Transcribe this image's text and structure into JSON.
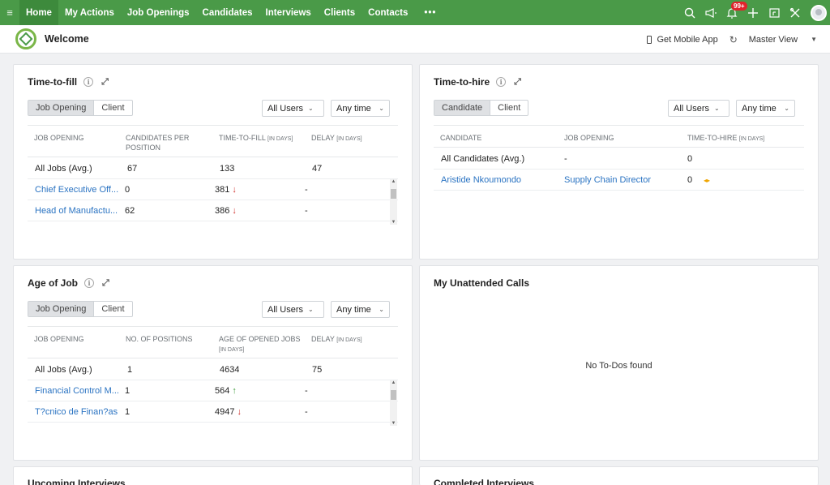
{
  "nav": {
    "items": [
      "Home",
      "My Actions",
      "Job Openings",
      "Candidates",
      "Interviews",
      "Clients",
      "Contacts"
    ],
    "more": "•••",
    "notification_badge": "99+",
    "icons": [
      "search-icon",
      "megaphone-icon",
      "bell-icon",
      "plus-icon",
      "calendar-icon",
      "tools-icon",
      "avatar"
    ]
  },
  "subheader": {
    "welcome": "Welcome",
    "mobile_app": "Get Mobile App",
    "view": "Master View"
  },
  "ttf": {
    "title": "Time-to-fill",
    "tabs": [
      "Job Opening",
      "Client"
    ],
    "users": "All Users",
    "time": "Any time",
    "headers": {
      "job": "JOB OPENING",
      "cand1": "CANDIDATES PER",
      "cand2": "POSITION",
      "ttf": "TIME-TO-FILL",
      "ttf_unit": "[IN DAYS]",
      "delay": "DELAY",
      "delay_unit": "[IN DAYS]"
    },
    "rows": [
      {
        "job": "All Jobs (Avg.)",
        "cand": "67",
        "ttf": "133",
        "arrow": "",
        "delay": "47"
      },
      {
        "job": "Chief Executive Off...",
        "cand": "0",
        "ttf": "381",
        "arrow": "↓",
        "delay": "-"
      },
      {
        "job": "Head of Manufactu...",
        "cand": "62",
        "ttf": "386",
        "arrow": "↓",
        "delay": "-"
      }
    ]
  },
  "tth": {
    "title": "Time-to-hire",
    "tabs": [
      "Candidate",
      "Client"
    ],
    "users": "All Users",
    "time": "Any time",
    "headers": {
      "cand": "CANDIDATE",
      "job": "JOB OPENING",
      "tth": "TIME-TO-HIRE",
      "tth_unit": "[IN DAYS]"
    },
    "rows": [
      {
        "cand": "All Candidates (Avg.)",
        "job": "-",
        "tth": "0"
      },
      {
        "cand": "Aristide Nkoumondo",
        "job": "Supply Chain Director",
        "tth": "0",
        "flag": "◂▸"
      }
    ]
  },
  "aoj": {
    "title": "Age of Job",
    "tabs": [
      "Job Opening",
      "Client"
    ],
    "users": "All Users",
    "time": "Any time",
    "headers": {
      "job": "JOB OPENING",
      "pos": "NO. OF POSITIONS",
      "age1": "AGE OF OPENED JOBS",
      "age_unit": "[IN DAYS]",
      "delay": "DELAY",
      "delay_unit": "[IN DAYS]"
    },
    "rows": [
      {
        "job": "All Jobs (Avg.)",
        "pos": "1",
        "age": "4634",
        "arrow": "",
        "delay": "75"
      },
      {
        "job": "Financial Control M...",
        "pos": "1",
        "age": "564",
        "arrow": "↑",
        "delay": "-"
      },
      {
        "job": "T?cnico de Finan?as",
        "pos": "1",
        "age": "4947",
        "arrow": "↓",
        "delay": "-"
      }
    ]
  },
  "calls": {
    "title": "My Unattended Calls",
    "empty": "No To-Dos found"
  },
  "bottom": {
    "upcoming": "Upcoming Interviews",
    "completed": "Completed Interviews"
  }
}
